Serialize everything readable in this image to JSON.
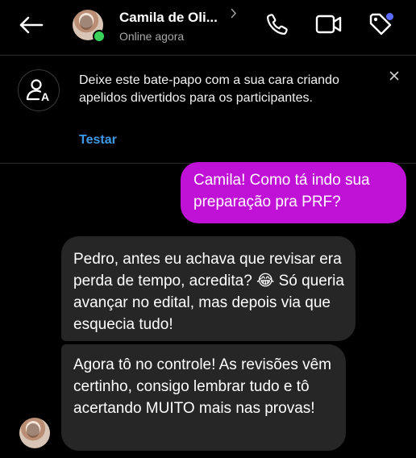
{
  "header": {
    "contact_name": "Camila de Oli...",
    "status": "Online agora",
    "icons": [
      "back-arrow-icon",
      "chevron-right-icon",
      "phone-icon",
      "video-camera-icon",
      "tag-icon"
    ]
  },
  "banner": {
    "text": "Deixe este bate-papo com a sua cara criando apelidos divertidos para os participantes.",
    "action": "Testar",
    "icons": [
      "nickname-person-icon",
      "close-icon"
    ]
  },
  "messages": [
    {
      "direction": "sent",
      "text": "Camila! Como tá indo sua preparação pra PRF?"
    },
    {
      "direction": "received",
      "text": "Pedro, antes eu achava que revisar era perda de tempo, acredita? 😂 Só queria avançar no edital, mas depois via que esquecia tudo!"
    },
    {
      "direction": "received",
      "text": "Agora tô no controle! As revisões vêm certinho, consigo lembrar tudo e tô acertando MUITO mais nas provas!"
    }
  ],
  "colors": {
    "background": "#000000",
    "sent_bubble": "#c011d6",
    "received_bubble": "#262626",
    "link": "#3f9ae6",
    "online": "#3ad05a",
    "notification": "#5c6bff"
  }
}
